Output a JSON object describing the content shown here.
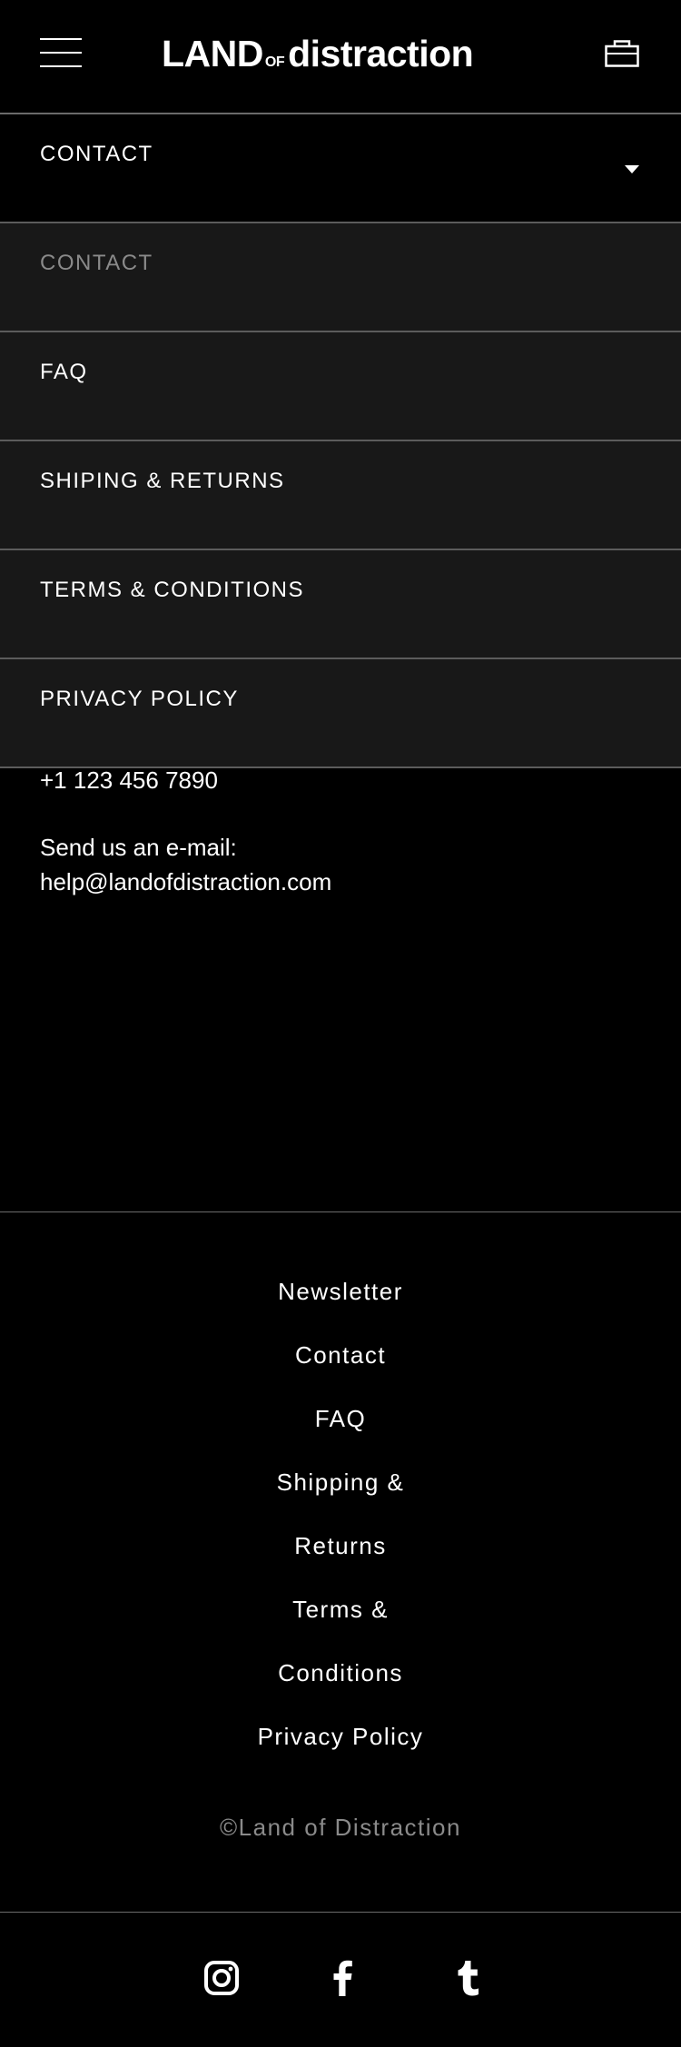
{
  "header": {
    "logo": {
      "part1": "LAND",
      "part2": "OF",
      "part3": "distraction"
    },
    "menu_icon": "hamburger-icon",
    "cart_icon": "bag-icon"
  },
  "dropdown": {
    "label": "CONTACT",
    "icon": "caret-down-icon"
  },
  "menu_items": [
    {
      "label": "CONTACT",
      "active": true
    },
    {
      "label": "FAQ",
      "active": false
    },
    {
      "label": "SHIPING & RETURNS",
      "active": false
    },
    {
      "label": "TERMS & CONDITIONS",
      "active": false
    },
    {
      "label": "PRIVACY POLICY",
      "active": false
    }
  ],
  "contact": {
    "phone": "+1 123 456 7890",
    "email_prompt": "Send us an e-mail:",
    "email": "help@landofdistraction.com"
  },
  "footer": {
    "links": [
      "Newsletter",
      "Contact",
      "FAQ",
      "Shipping & Returns",
      "Terms & Conditions",
      "Privacy Policy"
    ],
    "copyright": "©Land of Distraction"
  },
  "social": [
    "instagram-icon",
    "facebook-icon",
    "tumblr-icon"
  ],
  "colors": {
    "background": "#000000",
    "menu_background": "#181818",
    "divider": "#5c5c5c",
    "muted_text": "#8a8a8a",
    "text": "#ffffff"
  }
}
